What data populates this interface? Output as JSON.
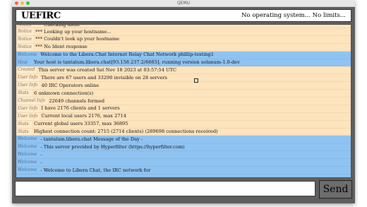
{
  "window": {
    "title": "QEMU"
  },
  "header": {
    "app_name": "UEFIRC",
    "status": "No operating system... No limits..."
  },
  "log": [
    {
      "tag": "Notice",
      "text": "*** Checking ident",
      "kind": "notice"
    },
    {
      "tag": "Notice",
      "text": "*** Looking up your hostname...",
      "kind": "notice"
    },
    {
      "tag": "Notice",
      "text": "*** Couldn't look up your hostname",
      "kind": "notice"
    },
    {
      "tag": "Notice",
      "text": "*** No Ident response",
      "kind": "notice"
    },
    {
      "tag": "Welcome",
      "text": "Welcome to the Libera.Chat Internet Relay Chat Network phillip-testing1",
      "kind": "welcome"
    },
    {
      "tag": "Host",
      "text": "Your host is tantalum.libera.chat[93.158.237.2/6665], running version solanum-1.0-dev",
      "kind": "welcome"
    },
    {
      "tag": "Created",
      "text": "This server was created Sat Nov 18 2023 at 03:57:54 UTC",
      "kind": "info"
    },
    {
      "tag": "User Info",
      "text": "There are 67 users and 33290 invisible on 28 servers",
      "kind": "info"
    },
    {
      "tag": "User Info",
      "text": "40 IRC Operators online",
      "kind": "info"
    },
    {
      "tag": "Stats",
      "text": "6 unknown connection(s)",
      "kind": "info"
    },
    {
      "tag": "Channel Info",
      "text": "22649 channels formed",
      "kind": "info"
    },
    {
      "tag": "User Info",
      "text": "I have 2176 clients and 1 servers",
      "kind": "info"
    },
    {
      "tag": "User Info",
      "text": "Current local users 2176, max 2714",
      "kind": "info"
    },
    {
      "tag": "Stats",
      "text": "Current global users 33357, max 36895",
      "kind": "info"
    },
    {
      "tag": "Stats",
      "text": "Highest connection count: 2715 (2714 clients) (289698 connections received)",
      "kind": "info"
    },
    {
      "tag": "Welcome",
      "text": "- tantalum.libera.chat Message of the Day -",
      "kind": "welcome"
    },
    {
      "tag": "Welcome",
      "text": "- This server provided by Hyperfilter (https://hyperfilter.com)",
      "kind": "welcome"
    },
    {
      "tag": "Welcome",
      "text": "-",
      "kind": "welcome"
    },
    {
      "tag": "Welcome",
      "text": "-",
      "kind": "welcome"
    },
    {
      "tag": "Welcome",
      "text": "- Welcome to Libera Chat, the IRC network for",
      "kind": "welcome"
    }
  ],
  "input": {
    "value": ""
  },
  "send": {
    "label": "Send"
  }
}
